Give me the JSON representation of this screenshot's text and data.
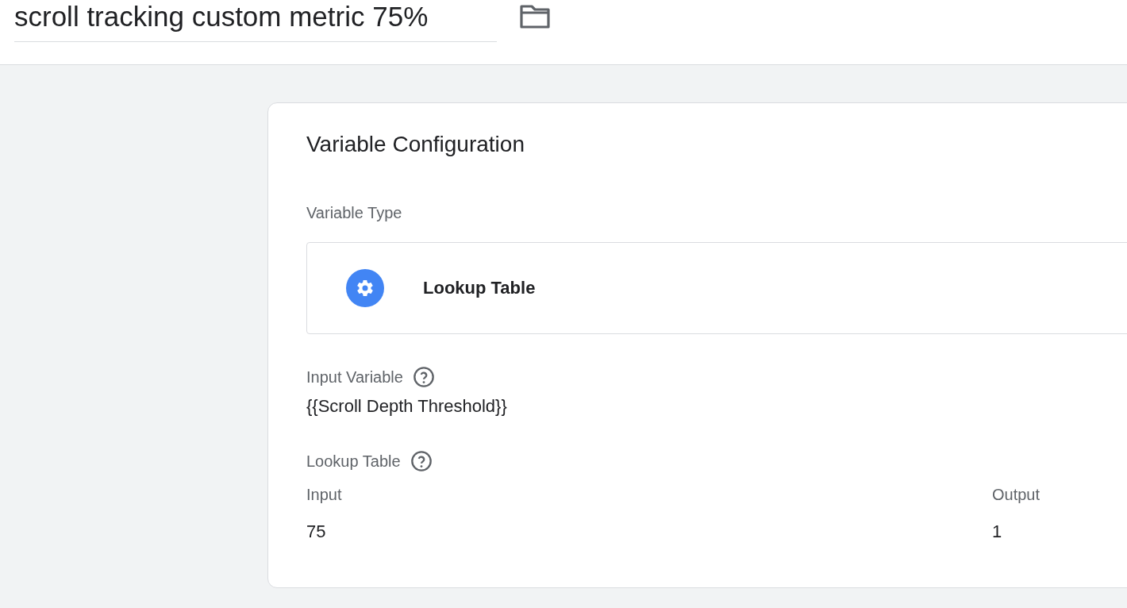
{
  "header": {
    "title": "scroll tracking custom metric 75%"
  },
  "card": {
    "title": "Variable Configuration",
    "variable_type_label": "Variable Type",
    "variable_type": "Lookup Table",
    "input_variable_label": "Input Variable",
    "input_variable": "{{Scroll Depth Threshold}}",
    "lookup_table_label": "Lookup Table",
    "table": {
      "columns": [
        "Input",
        "Output"
      ],
      "rows": [
        [
          "75",
          "1"
        ]
      ]
    }
  }
}
